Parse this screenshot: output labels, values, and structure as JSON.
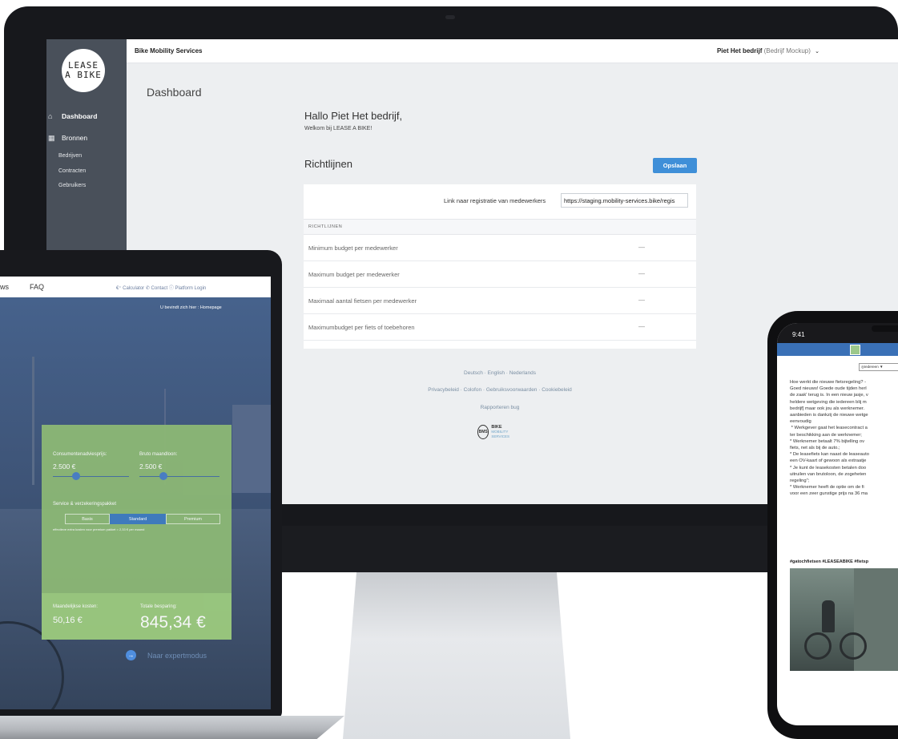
{
  "imac": {
    "sidebar": {
      "logo_line1": "LEASE",
      "logo_line2": "A BIKE",
      "items": [
        {
          "label": "Dashboard",
          "icon": "home-icon"
        },
        {
          "label": "Bronnen",
          "icon": "grid-icon"
        }
      ],
      "subitems": [
        "Bedrijven",
        "Contracten",
        "Gebruikers"
      ]
    },
    "topbar": {
      "brand": "Bike Mobility Services",
      "user_name": "Piet Het bedrijf",
      "user_company": "(Bedrijf Mockup)"
    },
    "main": {
      "page_title": "Dashboard",
      "greeting": "Hallo Piet Het bedrijf,",
      "welcome": "Welkom bij LEASE A BIKE!",
      "section_title": "Richtlijnen",
      "save_label": "Opslaan",
      "registration_label": "Link naar registratie van medewerkers",
      "registration_value": "https://staging.mobility-services.bike/regis",
      "table_header": "RICHTLIJNEN",
      "rows": [
        {
          "label": "Minimum budget per medewerker",
          "value": "—"
        },
        {
          "label": "Maximum budget per medewerker",
          "value": "—"
        },
        {
          "label": "Maximaal aantal fietsen per medewerker",
          "value": "—"
        },
        {
          "label": "Maximumbudget per fiets of toebehoren",
          "value": "—"
        }
      ]
    },
    "footer": {
      "languages": "Deutsch · English · Nederlands",
      "links": "Privacybeleid · Colofon · Gebruiksvoorwaarden · Cookiebeleid",
      "report_bug": "Rapporteren bug",
      "bms_badge": "BMS",
      "bms_title": "BIKE",
      "bms_subtitle": "MOBILITY SERVICES"
    }
  },
  "laptop": {
    "nav": {
      "partial_item": "ws",
      "faq": "FAQ",
      "tools": "€⁺ Calculator  ✆ Contact  ⓘ Platform Login"
    },
    "breadcrumb": "U bevindt zich hier :  Homepage",
    "calculator": {
      "price_label": "Consumentenadviesprijs:",
      "price_value": "2.500 €",
      "price_level": 0.3,
      "salary_label": "Bruto maandloon:",
      "salary_value": "2.500 €",
      "salary_level": 0.3,
      "package_label": "Service & verzekeringspakket",
      "packages": [
        "Basis",
        "Standard",
        "Premium"
      ],
      "selected_package": "Standard",
      "note": "effectieve extra kosten voor premium pakket = 2,33 € per maand",
      "monthly_label": "Maandelijkse kosten:",
      "monthly_value": "50,16 €",
      "savings_label": "Totale besparing:",
      "savings_value": "845,34 €"
    },
    "expert_mode": "Naar expertmodus"
  },
  "phone": {
    "time": "9:41",
    "audience_select": "◎Iedereen ▼",
    "post_text": "Hoe werkt die nieuwe fietsregeling? -\nGoed nieuws! Goede oude tijden herl\nde zaak' terug is. In een nieuw jasje, v\nheldere wetgeving die iedereen blij m\nbedrijf] maar ook jou als werknemer.\naanbieden is dankzij de nieuwe wetge\neenvoudig\n * Werkgever gaat het leasecontract a\nter beschikking aan de werknemer;\n* Werknemer betaalt 7% bijtelling ov\nfiets, net als bij de auto.;\n* De leasefiets kan naast de leaseauto\neen OV-kaart of gewoon als extraatje\n* Je kunt de leasekosten betalen doo\nuitruilen van brutoloon, de zogeheten\nregeling\";\n* Werknemer heeft de optie om de fi\nvoor een zeer gunstige prijs na 36 ma",
    "hashtags": "#gatochfietsen #LEASEABIKE #fietsp"
  },
  "colors": {
    "sidebar": "#49505a",
    "accent": "#3f8fd8",
    "calculator_green": "#8cb875",
    "phone_header": "#3a70b6"
  }
}
